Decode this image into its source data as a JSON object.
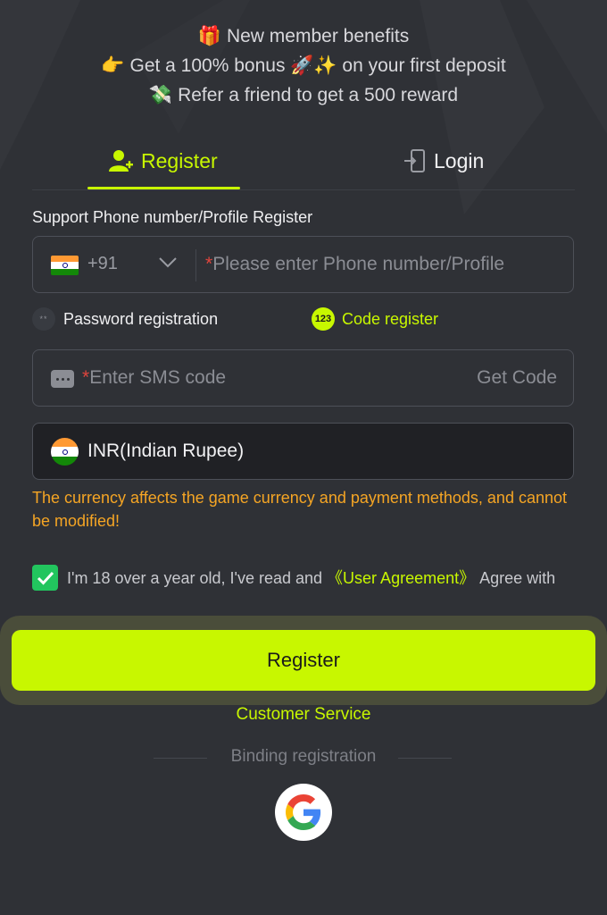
{
  "benefits": {
    "title": "New member benefits",
    "bonus": "Get a 100% bonus 🚀✨ on your first deposit",
    "refer": "Refer a friend to get a 500 reward"
  },
  "tabs": {
    "register": "Register",
    "login": "Login"
  },
  "form": {
    "section_label": "Support Phone number/Profile Register",
    "phone": {
      "country_code": "+91",
      "placeholder": "Please enter Phone number/Profile",
      "value": ""
    },
    "modes": {
      "password": "Password registration",
      "password_icon": "**",
      "code": "Code register",
      "code_icon": "123"
    },
    "sms": {
      "placeholder": "Enter SMS code",
      "get_code": "Get Code"
    },
    "currency": {
      "value": "INR(Indian Rupee)"
    },
    "currency_note": "The currency affects the game currency and payment methods, and cannot be modified!",
    "agreement": {
      "checked": true,
      "prefix": "I'm 18 over a year old, I've read and ",
      "link": "《User Agreement》",
      "suffix": " Agree with"
    },
    "submit": "Register"
  },
  "customer_service": "Customer Service",
  "binding": {
    "label": "Binding registration",
    "providers": [
      "google"
    ]
  },
  "colors": {
    "background": "#2f3136",
    "accent": "#c8f700",
    "warning": "#f5a524",
    "required": "#e0453d",
    "checkbox": "#22c55e"
  }
}
